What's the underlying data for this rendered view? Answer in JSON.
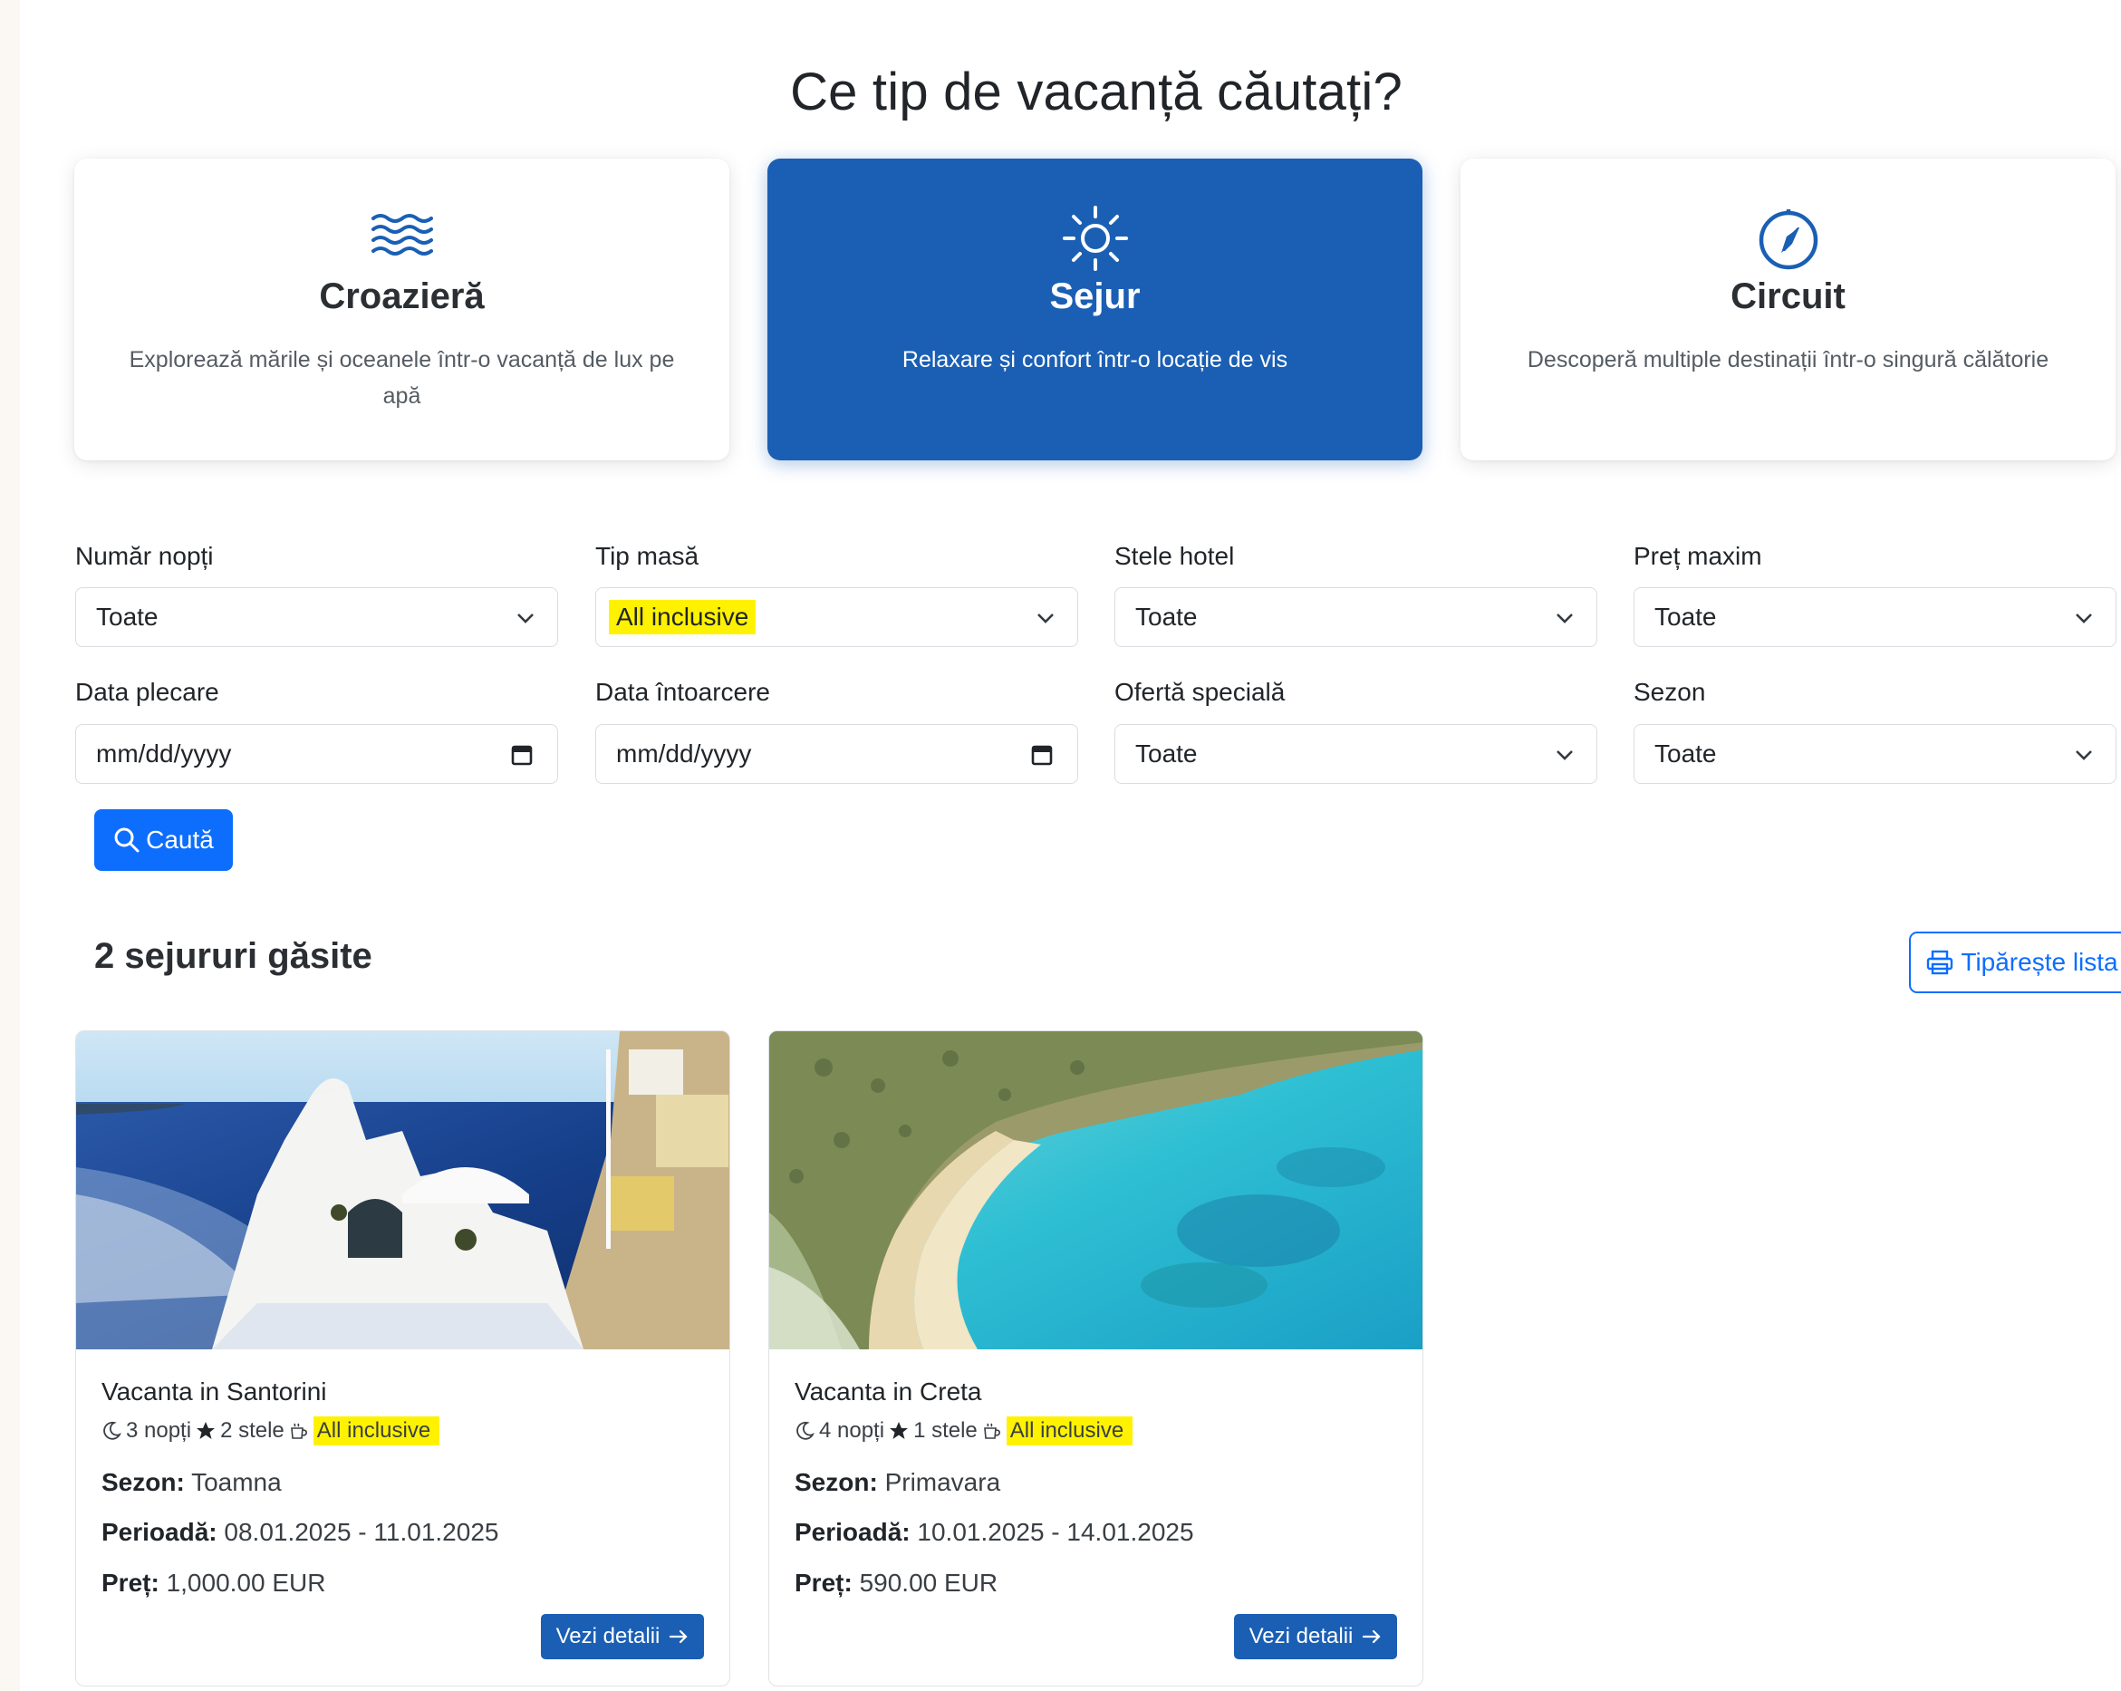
{
  "title": "Ce tip de vacanță căutați?",
  "types": [
    {
      "icon": "waves-icon",
      "name": "Croazieră",
      "desc": "Explorează mările și oceanele într-o vacanță de lux pe apă",
      "active": false
    },
    {
      "icon": "sun-icon",
      "name": "Sejur",
      "desc": "Relaxare și confort într-o locație de vis",
      "active": true
    },
    {
      "icon": "compass-icon",
      "name": "Circuit",
      "desc": "Descoperă multiple destinații într-o singură călătorie",
      "active": false
    }
  ],
  "filters": {
    "nights": {
      "label": "Număr nopți",
      "value": "Toate"
    },
    "meal": {
      "label": "Tip masă",
      "value": "All inclusive"
    },
    "stars": {
      "label": "Stele hotel",
      "value": "Toate"
    },
    "max_price": {
      "label": "Preț maxim",
      "value": "Toate"
    },
    "departure": {
      "label": "Data plecare",
      "placeholder": "mm/dd/yyyy"
    },
    "return": {
      "label": "Data întoarcere",
      "placeholder": "mm/dd/yyyy"
    },
    "special_offer": {
      "label": "Ofertă specială",
      "value": "Toate"
    },
    "season": {
      "label": "Sezon",
      "value": "Toate"
    }
  },
  "search_button": "Caută",
  "results": {
    "count_label": "2 sejururi găsite",
    "print_button": "Tipărește lista",
    "items": [
      {
        "name": "Vacanta in Santorini",
        "nights": "3 nopți",
        "stars": "2 stele",
        "meal": "All inclusive",
        "season_label": "Sezon:",
        "season": "Toamna",
        "period_label": "Perioadă:",
        "period": "08.01.2025 - 11.01.2025",
        "price_label": "Preț:",
        "price": "1,000.00 EUR",
        "details_button": "Vezi detalii"
      },
      {
        "name": "Vacanta in Creta",
        "nights": "4 nopți",
        "stars": "1 stele",
        "meal": "All inclusive",
        "season_label": "Sezon:",
        "season": "Primavara",
        "period_label": "Perioadă:",
        "period": "10.01.2025 - 14.01.2025",
        "price_label": "Preț:",
        "price": "590.00 EUR",
        "details_button": "Vezi detalii"
      }
    ]
  },
  "colors": {
    "primary": "#0d6efd",
    "active_card": "#1a5fb4",
    "highlight": "#fff200"
  }
}
